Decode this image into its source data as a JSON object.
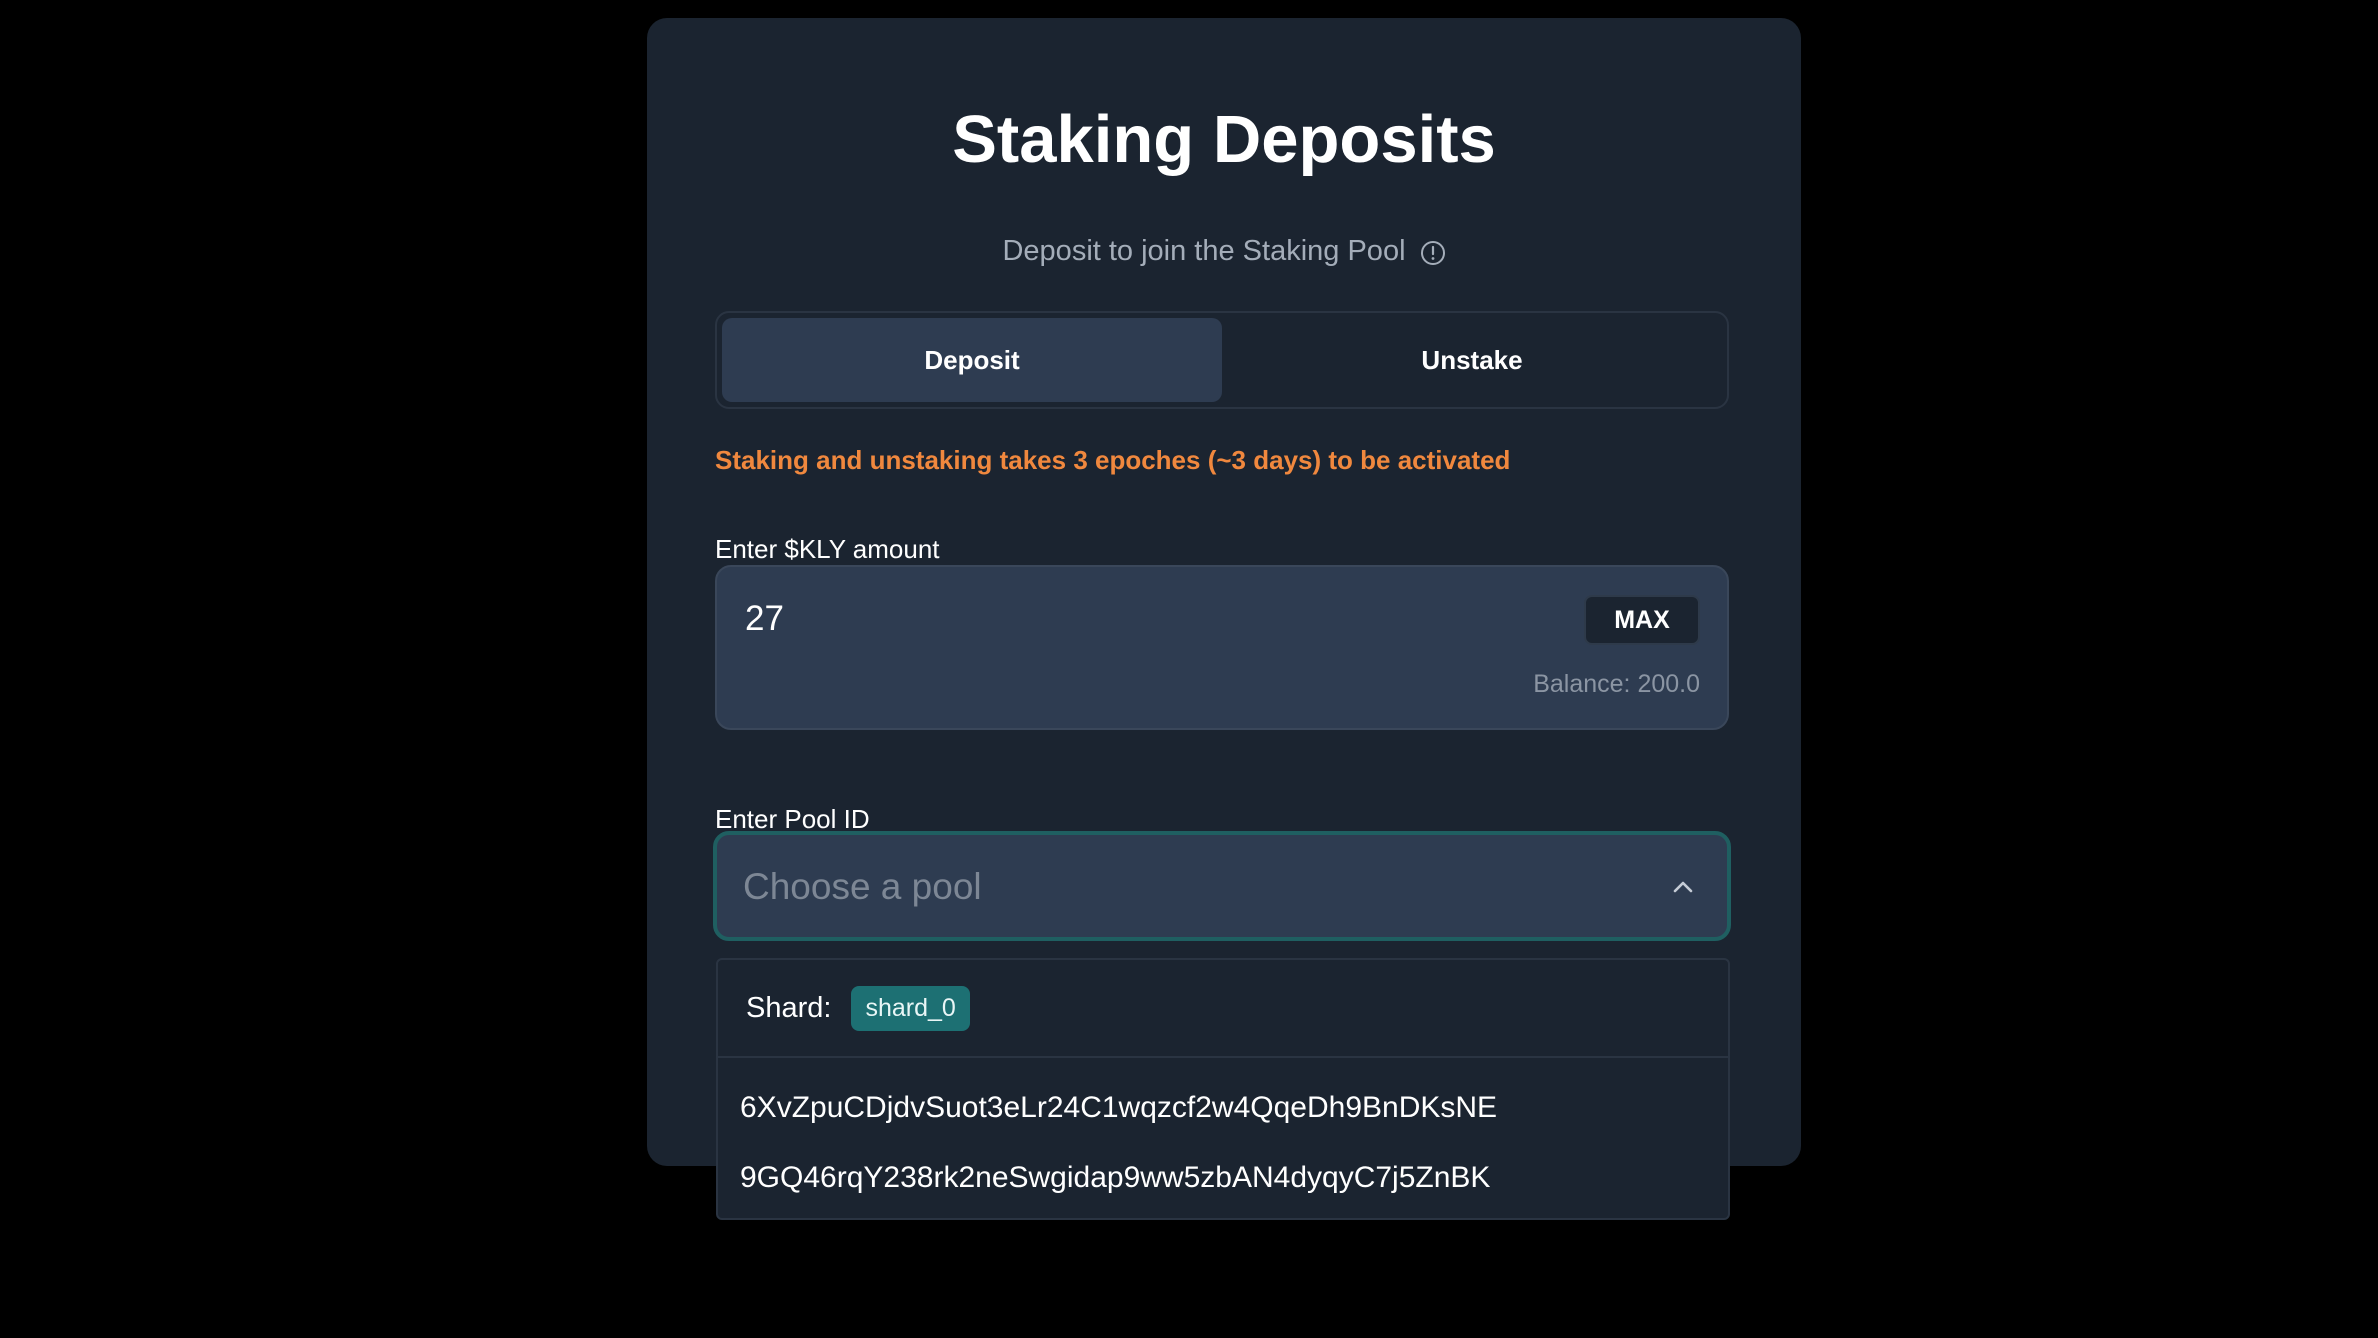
{
  "header": {
    "title": "Staking Deposits",
    "subtitle": "Deposit to join the Staking Pool"
  },
  "tabs": [
    {
      "label": "Deposit",
      "active": true
    },
    {
      "label": "Unstake",
      "active": false
    }
  ],
  "warning": "Staking and unstaking takes 3 epoches (~3 days) to be activated",
  "amount": {
    "label": "Enter $KLY amount",
    "value": "27",
    "max_label": "MAX",
    "balance": "Balance: 200.0"
  },
  "pool": {
    "label": "Enter Pool ID",
    "placeholder": "Choose a pool",
    "shard_label": "Shard:",
    "shard_value": "shard_0",
    "options": [
      "6XvZpuCDjdvSuot3eLr24C1wqzcf2w4QqeDh9BnDKsNE",
      "9GQ46rqY238rk2neSwgidap9ww5zbAN4dyqyC7j5ZnBK"
    ]
  },
  "colors": {
    "background": "#000000",
    "card": "#1b2430",
    "accent_warning": "#f0883e",
    "accent_teal": "#1d7073"
  },
  "icons": {
    "info": "info-icon",
    "chevron": "chevron-up-icon"
  }
}
